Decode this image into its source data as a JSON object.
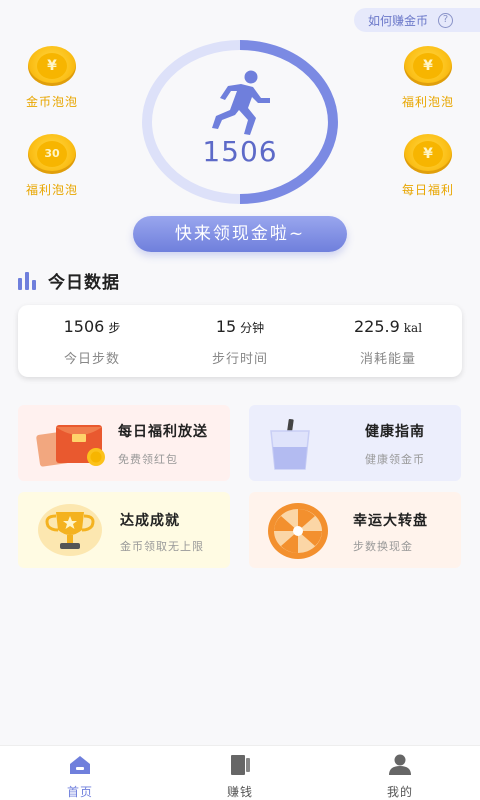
{
  "header": {
    "howto_label": "如何赚金币",
    "help_symbol": "?"
  },
  "bubbles": [
    {
      "label": "金币泡泡",
      "coin_text": "¥"
    },
    {
      "label": "福利泡泡",
      "coin_text": "30"
    },
    {
      "label": "福利泡泡",
      "coin_text": "¥"
    },
    {
      "label": "每日福利",
      "coin_text": "¥"
    }
  ],
  "steps": {
    "count": "1506",
    "progress_fraction": 0.5
  },
  "cta_label": "快来领现金啦~",
  "today": {
    "title": "今日数据",
    "stats": [
      {
        "value": "1506",
        "unit": "步",
        "caption": "今日步数"
      },
      {
        "value": "15",
        "unit": "分钟",
        "caption": "步行时间"
      },
      {
        "value": "225.9",
        "unit": "kal",
        "caption": "消耗能量"
      }
    ]
  },
  "cards": [
    {
      "title": "每日福利放送",
      "subtitle": "免费领红包",
      "bg": "#fff1ef"
    },
    {
      "title": "健康指南",
      "subtitle": "健康领金币",
      "bg": "#eceefc"
    },
    {
      "title": "达成成就",
      "subtitle": "金币领取无上限",
      "bg": "#fffbe3"
    },
    {
      "title": "幸运大转盘",
      "subtitle": "步数换现金",
      "bg": "#fff3ec"
    }
  ],
  "tabs": [
    {
      "label": "首页",
      "active": true
    },
    {
      "label": "赚钱",
      "active": false
    },
    {
      "label": "我的",
      "active": false
    }
  ],
  "colors": {
    "accent": "#6f7fdc",
    "gold": "#fcc21b",
    "gold_text": "#e8a600"
  }
}
